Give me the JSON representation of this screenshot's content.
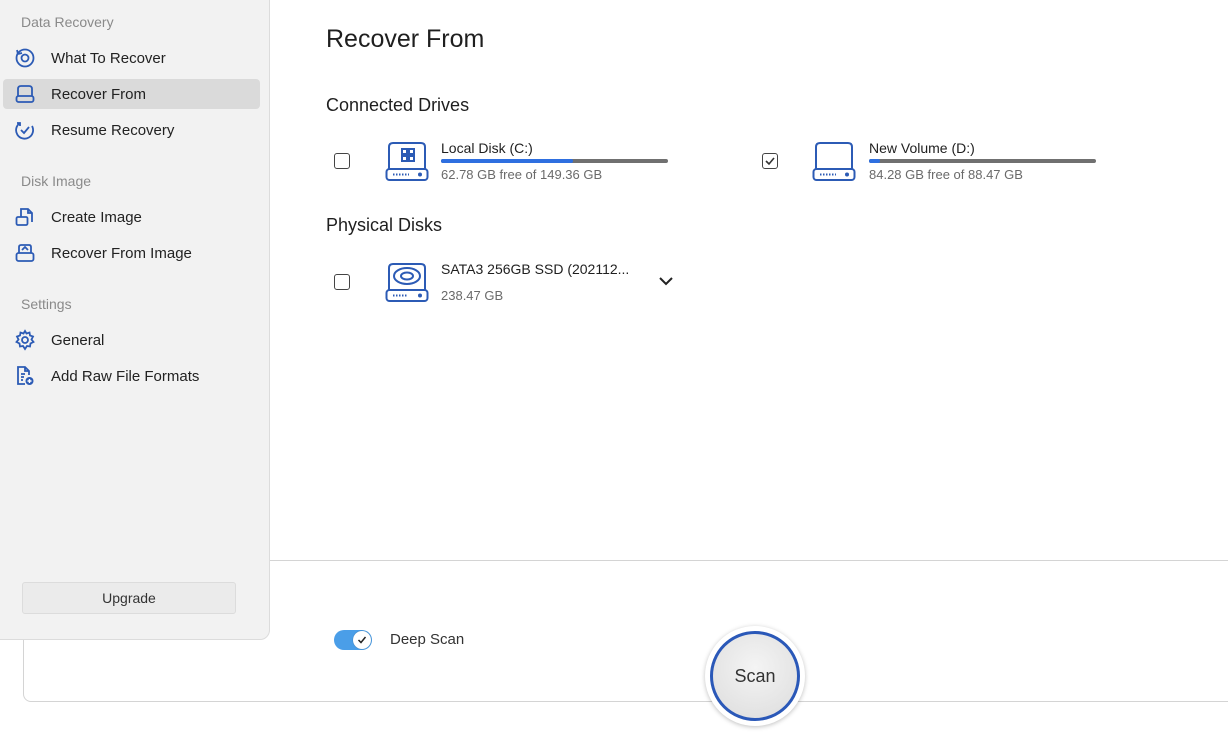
{
  "sidebar": {
    "sections": [
      {
        "title": "Data Recovery"
      },
      {
        "title": "Disk Image"
      },
      {
        "title": "Settings"
      }
    ],
    "items": [
      {
        "label": "What To Recover",
        "icon": "history-icon"
      },
      {
        "label": "Recover From",
        "icon": "drive-icon",
        "active": true
      },
      {
        "label": "Resume Recovery",
        "icon": "resume-icon"
      },
      {
        "label": "Create Image",
        "icon": "create-image-icon"
      },
      {
        "label": "Recover From Image",
        "icon": "recover-image-icon"
      },
      {
        "label": "General",
        "icon": "gear-icon"
      },
      {
        "label": "Add Raw File Formats",
        "icon": "add-file-icon"
      }
    ],
    "upgrade_label": "Upgrade"
  },
  "main": {
    "title": "Recover From",
    "connected_drives_heading": "Connected Drives",
    "physical_disks_heading": "Physical Disks",
    "drives": [
      {
        "name": "Local Disk (C:)",
        "detail": "62.78 GB free of 149.36 GB",
        "checked": false,
        "used_fraction": 0.58
      },
      {
        "name": "New Volume (D:)",
        "detail": "84.28 GB free of 88.47 GB",
        "checked": true,
        "used_fraction": 0.05
      }
    ],
    "physical_disks": [
      {
        "name": "SATA3 256GB SSD (202112...",
        "detail": "238.47 GB",
        "checked": false
      }
    ]
  },
  "footer": {
    "deep_scan_label": "Deep Scan",
    "deep_scan_on": true,
    "scan_label": "Scan"
  },
  "colors": {
    "accent": "#2e6fe0",
    "toggle": "#4a9ee8",
    "scan_ring": "#2a58b8",
    "sidebar_bg": "#f2f2f2",
    "active_item_bg": "#dadada"
  }
}
